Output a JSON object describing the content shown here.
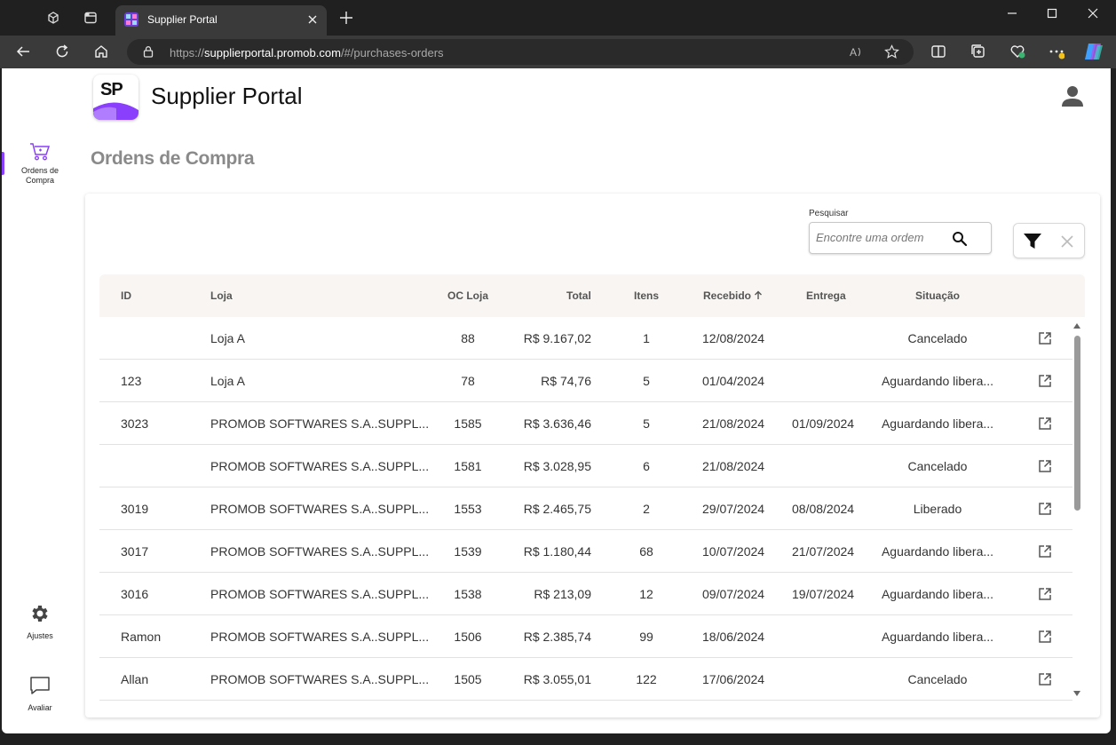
{
  "browser": {
    "tab_title": "Supplier Portal",
    "url_prefix": "https://",
    "url_host": "supplierportal.promob.com",
    "url_path": "/#/purchases-orders"
  },
  "sidebar": {
    "items": [
      {
        "label_line1": "Ordens de",
        "label_line2": "Compra",
        "icon": "cart-icon",
        "active": true
      },
      {
        "label": "Ajustes",
        "icon": "gear-icon"
      },
      {
        "label": "Avaliar",
        "icon": "chat-icon"
      }
    ]
  },
  "header": {
    "logo_text": "SP",
    "app_title": "Supplier Portal"
  },
  "page_title": "Ordens de Compra",
  "search": {
    "label": "Pesquisar",
    "placeholder": "Encontre uma ordem"
  },
  "colors": {
    "accent": "#8a3ffc",
    "header_bg": "#f8f5f2"
  },
  "table": {
    "columns": [
      "ID",
      "Loja",
      "OC Loja",
      "Total",
      "Itens",
      "Recebido",
      "Entrega",
      "Situação"
    ],
    "rows": [
      {
        "id": "",
        "loja": "Loja  A",
        "oc_loja": "88",
        "total": "R$ 9.167,02",
        "itens": "1",
        "recebido": "12/08/2024",
        "entrega": "",
        "situacao": "Cancelado"
      },
      {
        "id": "123",
        "loja": "Loja  A",
        "oc_loja": "78",
        "total": "R$ 74,76",
        "itens": "5",
        "recebido": "01/04/2024",
        "entrega": "",
        "situacao": "Aguardando libera..."
      },
      {
        "id": "3023",
        "loja": "PROMOB SOFTWARES S.A..SUPPL...",
        "oc_loja": "1585",
        "total": "R$ 3.636,46",
        "itens": "5",
        "recebido": "21/08/2024",
        "entrega": "01/09/2024",
        "situacao": "Aguardando libera..."
      },
      {
        "id": "",
        "loja": "PROMOB SOFTWARES S.A..SUPPL...",
        "oc_loja": "1581",
        "total": "R$ 3.028,95",
        "itens": "6",
        "recebido": "21/08/2024",
        "entrega": "",
        "situacao": "Cancelado"
      },
      {
        "id": "3019",
        "loja": "PROMOB SOFTWARES S.A..SUPPL...",
        "oc_loja": "1553",
        "total": "R$ 2.465,75",
        "itens": "2",
        "recebido": "29/07/2024",
        "entrega": "08/08/2024",
        "situacao": "Liberado"
      },
      {
        "id": "3017",
        "loja": "PROMOB SOFTWARES S.A..SUPPL...",
        "oc_loja": "1539",
        "total": "R$ 1.180,44",
        "itens": "68",
        "recebido": "10/07/2024",
        "entrega": "21/07/2024",
        "situacao": "Aguardando libera..."
      },
      {
        "id": "3016",
        "loja": "PROMOB SOFTWARES S.A..SUPPL...",
        "oc_loja": "1538",
        "total": "R$ 213,09",
        "itens": "12",
        "recebido": "09/07/2024",
        "entrega": "19/07/2024",
        "situacao": "Aguardando libera..."
      },
      {
        "id": "Ramon",
        "loja": "PROMOB SOFTWARES S.A..SUPPL...",
        "oc_loja": "1506",
        "total": "R$ 2.385,74",
        "itens": "99",
        "recebido": "18/06/2024",
        "entrega": "",
        "situacao": "Aguardando libera..."
      },
      {
        "id": "Allan",
        "loja": "PROMOB SOFTWARES S.A..SUPPL...",
        "oc_loja": "1505",
        "total": "R$ 3.055,01",
        "itens": "122",
        "recebido": "17/06/2024",
        "entrega": "",
        "situacao": "Cancelado"
      }
    ]
  }
}
